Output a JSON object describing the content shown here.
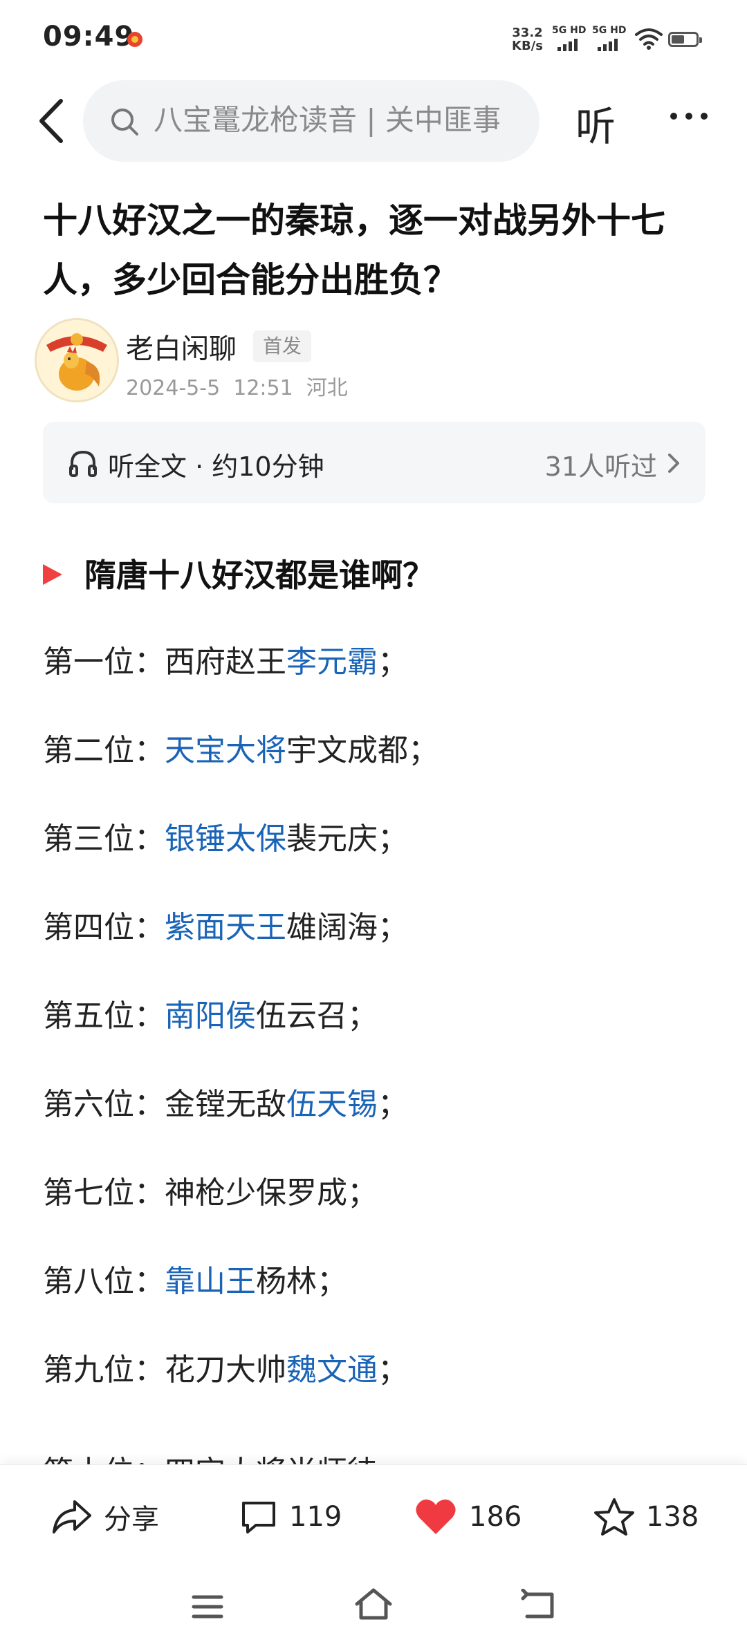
{
  "status_bar": {
    "time": "09:49",
    "net_speed_value": "33.2",
    "net_speed_unit": "KB/s",
    "sim1_label": "5G HD",
    "sim2_label": "5G HD",
    "notification_icon": "app-notification-icon",
    "wifi_icon": "wifi-icon",
    "battery_icon": "battery-icon"
  },
  "top_nav": {
    "back_icon": "back-arrow-icon",
    "search_text": "八宝鼍龙枪读音 | 关中匪事",
    "listen_label": "听",
    "more_icon": "more-dots-icon"
  },
  "article": {
    "title": "十八好汉之一的秦琼，逐一对战另外十七人，多少回合能分出胜负？",
    "author": "老白闲聊",
    "badge": "首发",
    "date": "2024-5-5",
    "time": "12:51",
    "location": "河北",
    "listen_bar": {
      "label": "听全文 · 约10分钟",
      "count": "31人听过"
    },
    "section_heading": "隋唐十八好汉都是谁啊？",
    "list": [
      {
        "rank": "第一位：",
        "pre": "西府赵王",
        "link": "李元霸",
        "post": "；"
      },
      {
        "rank": "第二位：",
        "pre": "",
        "link": "天宝大将",
        "post": "宇文成都；"
      },
      {
        "rank": "第三位：",
        "pre": "",
        "link": "银锤太保",
        "post": "裴元庆；"
      },
      {
        "rank": "第四位：",
        "pre": "",
        "link": "紫面天王",
        "post": "雄阔海；"
      },
      {
        "rank": "第五位：",
        "pre": "",
        "link": "南阳侯",
        "post": "伍云召；"
      },
      {
        "rank": "第六位：",
        "pre": "金镗无敌",
        "link": "伍天锡",
        "post": "；"
      },
      {
        "rank": "第七位：",
        "pre": "神枪少保罗成；",
        "link": "",
        "post": ""
      },
      {
        "rank": "第八位：",
        "pre": "",
        "link": "靠山王",
        "post": "杨林；"
      },
      {
        "rank": "第九位：",
        "pre": "花刀大帅",
        "link": "魏文通",
        "post": "；"
      }
    ],
    "partial_line": "第十位：四宝大将尚师徒"
  },
  "action_bar": {
    "share_label": "分享",
    "comments": "119",
    "likes": "186",
    "favorites": "138",
    "like_color": "#f03a42"
  },
  "nav_bar": {
    "menu_icon": "menu-icon",
    "home_icon": "home-icon",
    "back_icon": "back-icon"
  }
}
